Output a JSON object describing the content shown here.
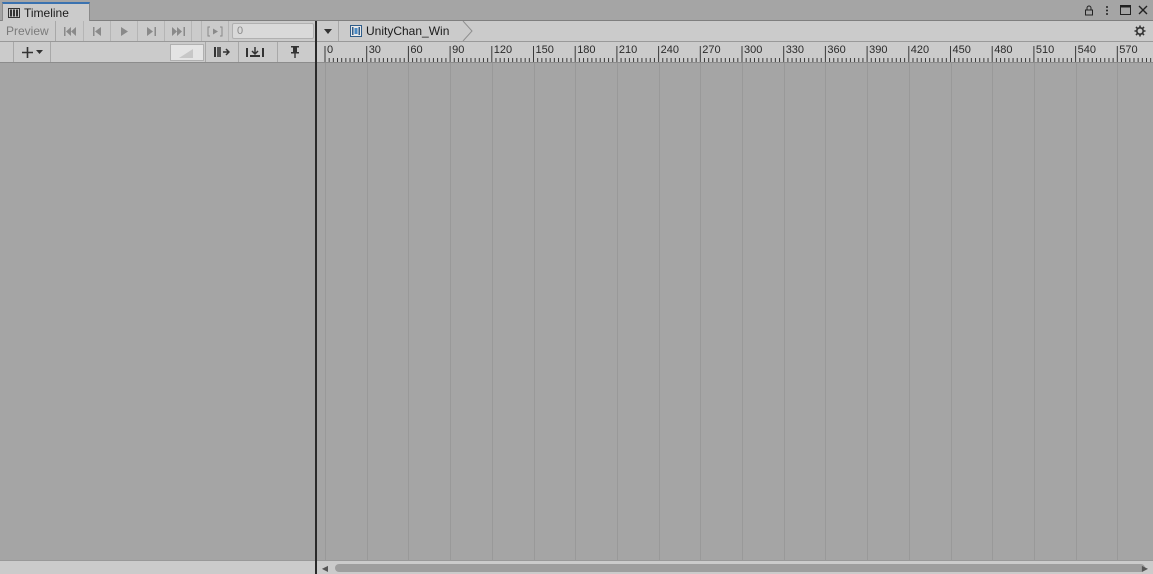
{
  "window": {
    "tab_title": "Timeline",
    "lock_icon": "lock-icon",
    "menu_icon": "kebab-menu-icon",
    "maximize_icon": "maximize-icon",
    "close_icon": "close-icon"
  },
  "toolbar": {
    "preview_label": "Preview",
    "frame_value": "0",
    "breadcrumb_label": "UnityChan_Win"
  },
  "ruler": {
    "labels": [
      "0",
      "30",
      "60",
      "90",
      "120",
      "150",
      "180",
      "210",
      "240",
      "270",
      "300",
      "330",
      "360",
      "390",
      "420",
      "450",
      "480",
      "510",
      "540",
      "570"
    ]
  },
  "colors": {
    "background": "#a5a5a5",
    "toolbar": "#cbcbcb",
    "tab_accent": "#3a72b0",
    "divider": "#2a2a2a"
  }
}
